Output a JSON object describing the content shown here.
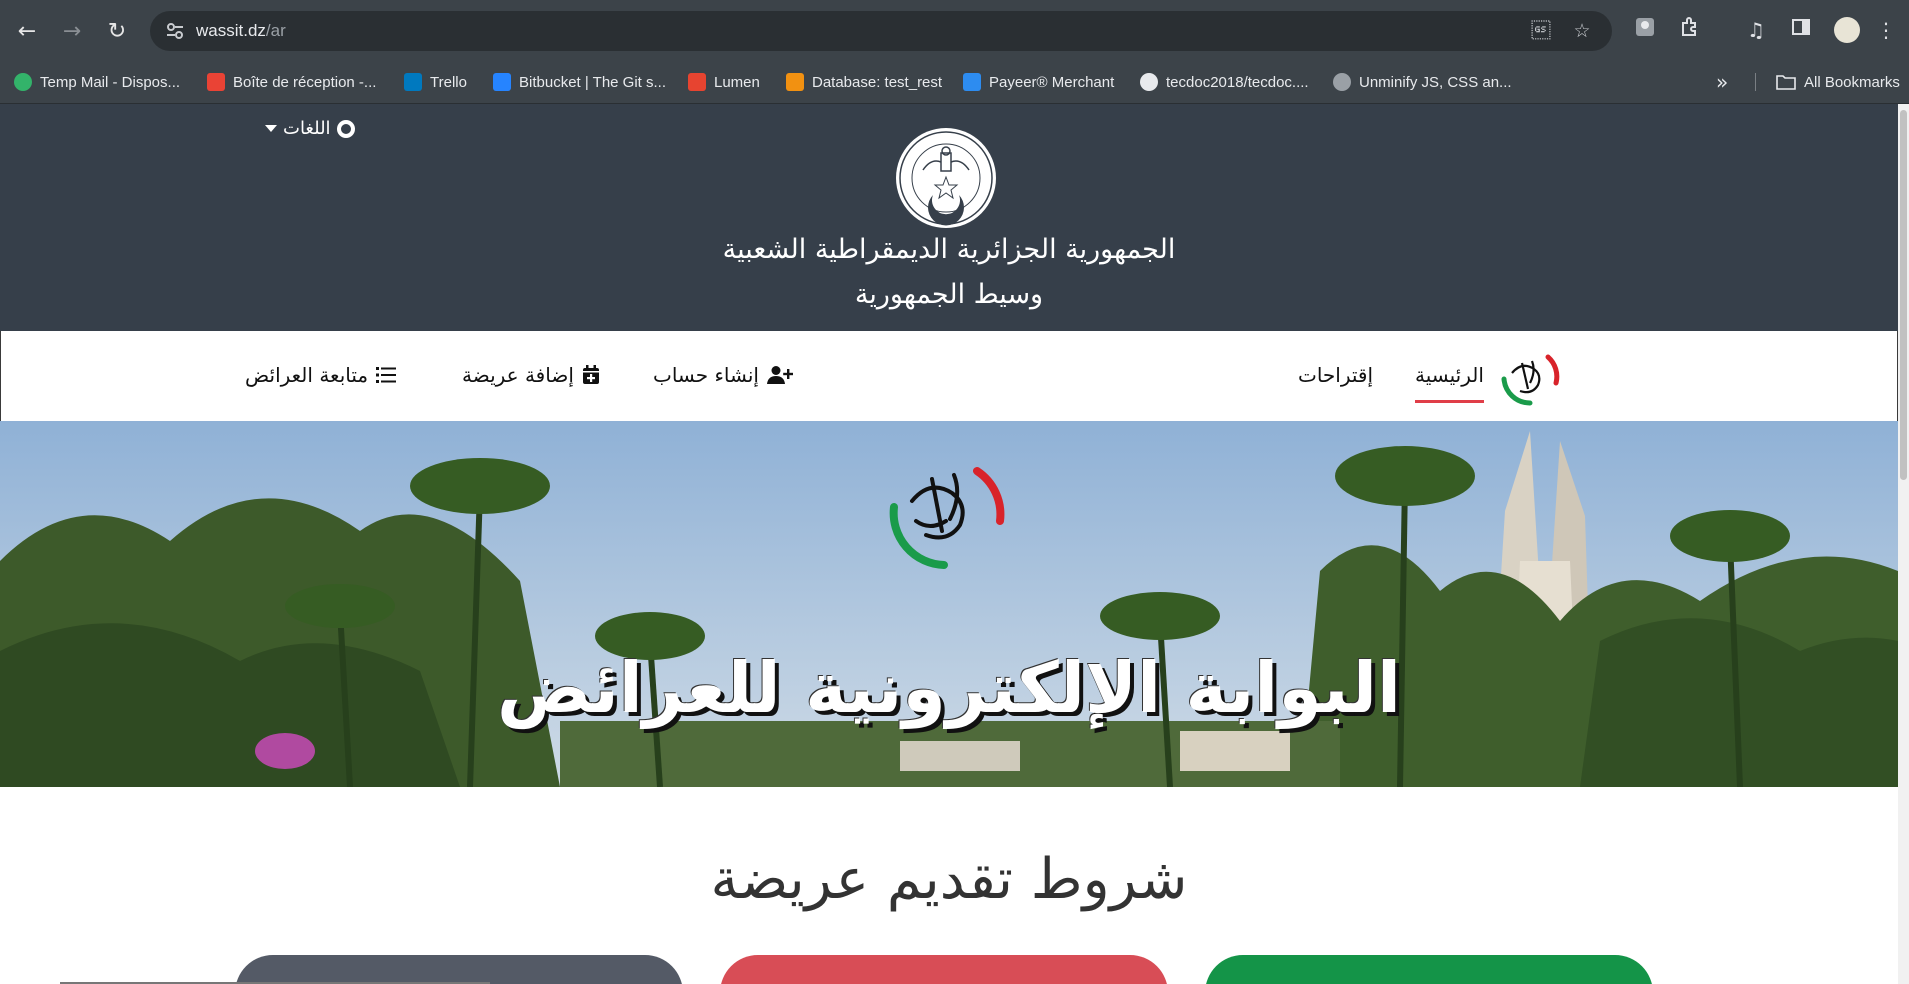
{
  "browser": {
    "url_host": "wassit.dz",
    "url_path": "/ar",
    "icons": {
      "back": "arrow-left",
      "forward": "arrow-right",
      "reload": "reload",
      "site_info": "tune",
      "translate": "translate",
      "bookmark": "star",
      "extension": "puzzle",
      "media": "music-list",
      "sidepanel": "sidepanel",
      "menu": "kebab"
    },
    "bookmarks": [
      {
        "label": "Temp Mail - Dispos...",
        "color": "#33b36a"
      },
      {
        "label": "Boîte de réception -...",
        "color": "#ea4335"
      },
      {
        "label": "Trello",
        "color": "#0079bf"
      },
      {
        "label": "Bitbucket | The Git s...",
        "color": "#2684ff"
      },
      {
        "label": "Lumen",
        "color": "#e74430"
      },
      {
        "label": "Database: test_rest",
        "color": "#f29111"
      },
      {
        "label": "Payeer® Merchant",
        "color": "#2d8cf0"
      },
      {
        "label": "tecdoc2018/tecdoc....",
        "color": "#1b1f23"
      },
      {
        "label": "Unminify JS, CSS an...",
        "color": "#3a3a3a"
      }
    ],
    "all_bookmarks": "All Bookmarks"
  },
  "header": {
    "language_label": "اللغات",
    "title_line1": "الجمهورية الجزائرية الديمقراطية الشعبية",
    "title_line2": "وسيط الجمهورية",
    "bg_color": "#363f4a"
  },
  "nav": {
    "home": "الرئيسية",
    "suggestions": "إقتراحات",
    "create_account": "إنشاء حساب",
    "add_petition": "إضافة عريضة",
    "track_petitions": "متابعة العرائض",
    "active_color": "#e03e48"
  },
  "hero": {
    "title": "البوابة الإلكترونية للعرائض"
  },
  "main": {
    "section_title": "شروط تقديم عريضة",
    "card_colors": [
      "#545a66",
      "#d84d56",
      "#149448"
    ]
  }
}
